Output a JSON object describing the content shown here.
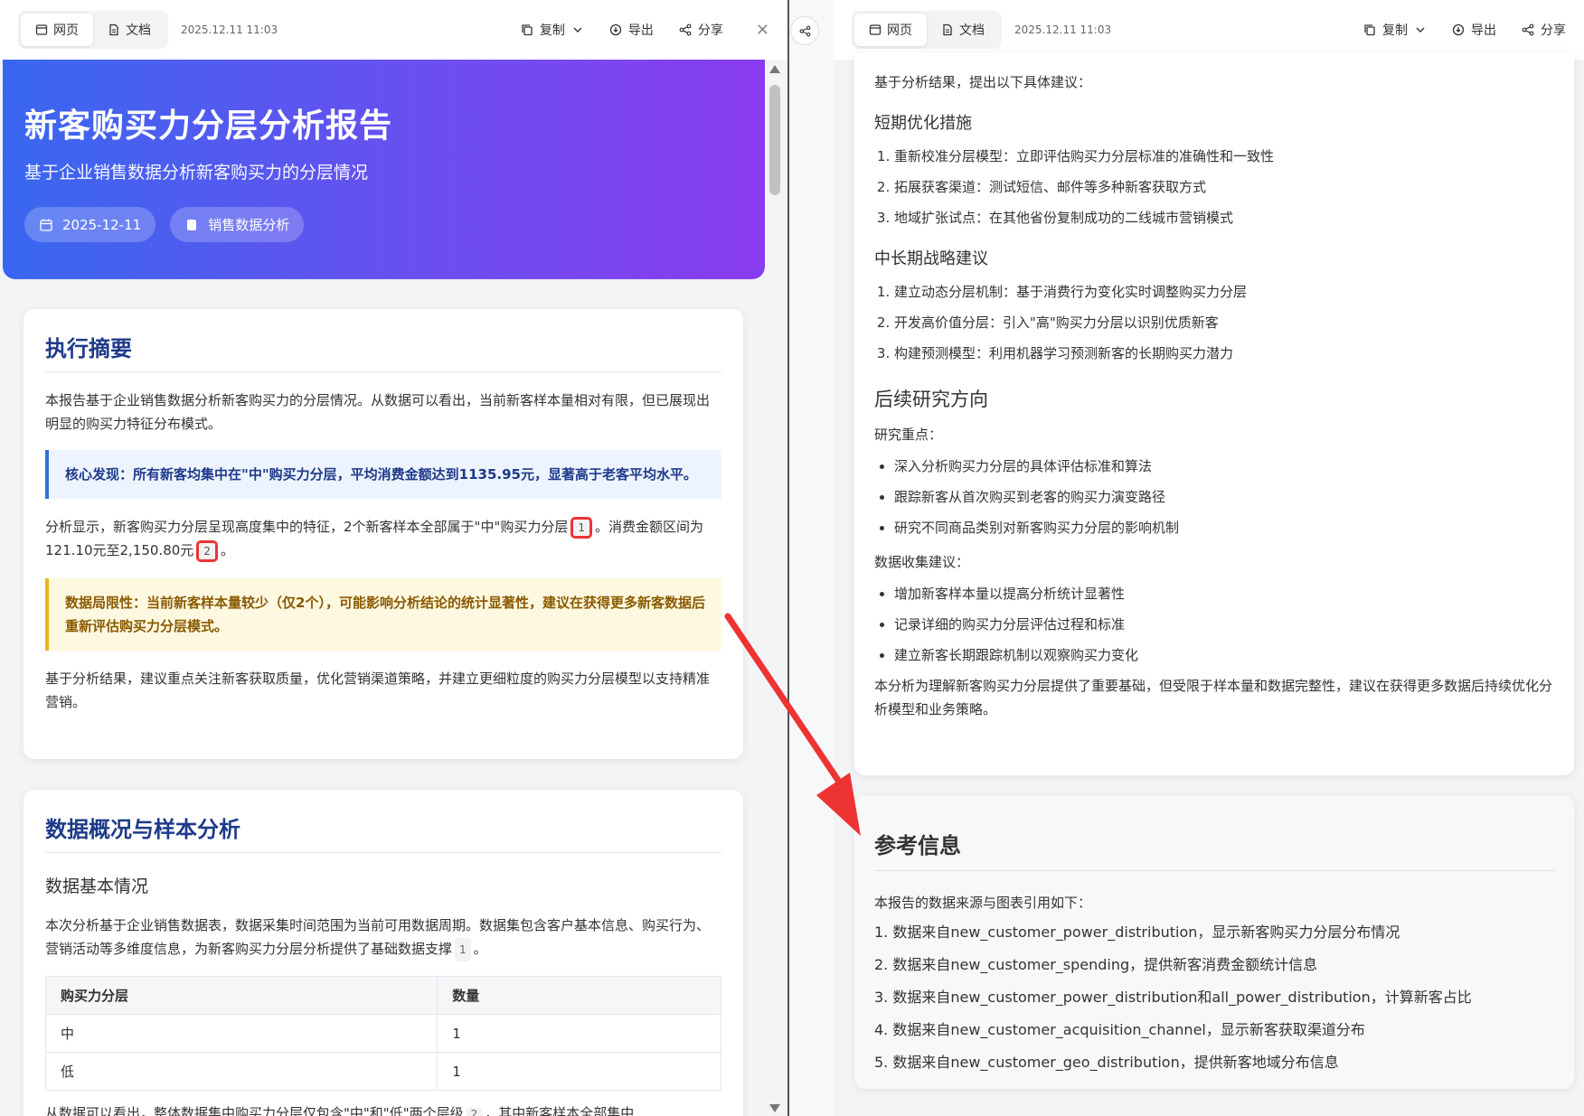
{
  "toolbar": {
    "tab_web": "网页",
    "tab_doc": "文档",
    "date": "2025.12.11 11:03",
    "copy": "复制",
    "export": "导出",
    "share": "分享"
  },
  "hero": {
    "title": "新客购买力分层分析报告",
    "subtitle": "基于企业销售数据分析新客购买力的分层情况",
    "tag_date": "2025-12-11",
    "tag_source": "销售数据分析"
  },
  "summary": {
    "heading": "执行摘要",
    "p1": "本报告基于企业销售数据分析新客购买力的分层情况。从数据可以看出，当前新客样本量相对有限，但已展现出明显的购买力特征分布模式。",
    "callout_core": "核心发现：所有新客均集中在\"中\"购买力分层，平均消费金额达到1135.95元，显著高于老客平均水平。",
    "p2_a": "分析显示，新客购买力分层呈现高度集中的特征，2个新客样本全部属于\"中\"购买力分层",
    "cite1": "1",
    "p2_b": "。消费金额区间为121.10元至2,150.80元",
    "cite2": "2",
    "p2_c": "。",
    "callout_limit": "数据局限性：当前新客样本量较少（仅2个），可能影响分析结论的统计显著性，建议在获得更多新客数据后重新评估购买力分层模式。",
    "p3": "基于分析结果，建议重点关注新客获取质量，优化营销渠道策略，并建立更细粒度的购买力分层模型以支持精准营销。"
  },
  "data_section": {
    "heading": "数据概况与样本分析",
    "sub": "数据基本情况",
    "p1": "本次分析基于企业销售数据表，数据采集时间范围为当前可用数据周期。数据集包含客户基本信息、购买行为、营销活动等多维度信息，为新客购买力分层分析提供了基础数据支撑",
    "cite": "1",
    "p1_end": "。",
    "table_headers": [
      "购买力分层",
      "数量"
    ],
    "table_rows": [
      [
        "中",
        "1"
      ],
      [
        "低",
        "1"
      ]
    ],
    "trunc": "从数据可以看出，整体数据集中购买力分层仅包含\"中\"和\"低\"两个层级",
    "trunc_cite": "2",
    "trunc_end": "，其中新客样本全部集中"
  },
  "right": {
    "intro": "基于分析结果，提出以下具体建议：",
    "short_title": "短期优化措施",
    "short_items": [
      "重新校准分层模型：立即评估购买力分层标准的准确性和一致性",
      "拓展获客渠道：测试短信、邮件等多种新客获取方式",
      "地域扩张试点：在其他省份复制成功的二线城市营销模式"
    ],
    "long_title": "中长期战略建议",
    "long_items": [
      "建立动态分层机制：基于消费行为变化实时调整购买力分层",
      "开发高价值分层：引入\"高\"购买力分层以识别优质新客",
      "构建预测模型：利用机器学习预测新客的长期购买力潜力"
    ],
    "research_title": "后续研究方向",
    "focus_label": "研究重点：",
    "focus_items": [
      "深入分析购买力分层的具体评估标准和算法",
      "跟踪新客从首次购买到老客的购买力演变路径",
      "研究不同商品类别对新客购买力分层的影响机制"
    ],
    "collect_label": "数据收集建议：",
    "collect_items": [
      "增加新客样本量以提高分析统计显著性",
      "记录详细的购买力分层评估过程和标准",
      "建立新客长期跟踪机制以观察购买力变化"
    ],
    "closing": "本分析为理解新客购买力分层提供了重要基础，但受限于样本量和数据完整性，建议在获得更多数据后持续优化分析模型和业务策略。"
  },
  "references": {
    "heading": "参考信息",
    "intro": "本报告的数据来源与图表引用如下：",
    "items": [
      "1. 数据来自new_customer_power_distribution，显示新客购买力分层分布情况",
      "2. 数据来自new_customer_spending，提供新客消费金额统计信息",
      "3. 数据来自new_customer_power_distribution和all_power_distribution，计算新客占比",
      "4. 数据来自new_customer_acquisition_channel，显示新客获取渠道分布",
      "5. 数据来自new_customer_geo_distribution，提供新客地域分布信息"
    ]
  },
  "colors": {
    "hero_start": "#3867f0",
    "hero_end": "#8a3cf0",
    "heading_blue": "#1e3a8a",
    "callout_blue": "#2f6fe0",
    "callout_yellow": "#e4b520",
    "annotation_red": "#e33"
  },
  "icons": [
    "web-icon",
    "doc-icon",
    "copy-icon",
    "export-icon",
    "share-icon",
    "close-icon",
    "calendar-icon",
    "database-icon",
    "chevron-down-icon"
  ]
}
